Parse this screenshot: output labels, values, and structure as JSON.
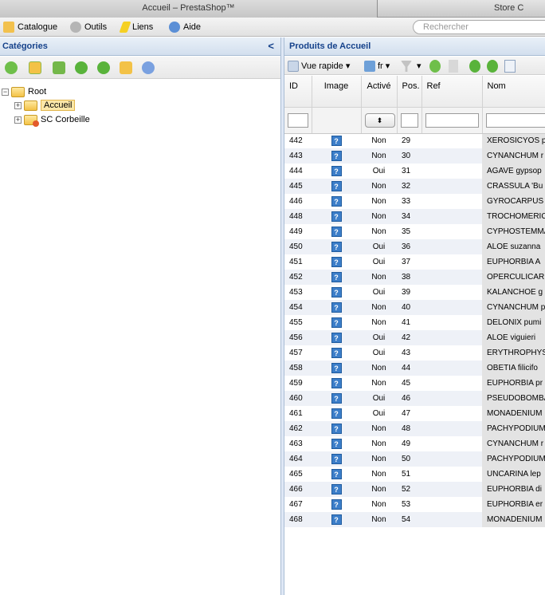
{
  "tabs": {
    "active": "Accueil – PrestaShop™",
    "second": "Store C"
  },
  "menu": {
    "items": [
      "Catalogue",
      "Outils",
      "Liens",
      "Aide"
    ],
    "search_placeholder": "Rechercher"
  },
  "left_panel": {
    "title": "Catégories",
    "collapse_glyph": "<",
    "toolbar_icons": [
      "refresh-icon",
      "expand-icon",
      "collapse-tree-icon",
      "add-icon",
      "add-subcategory-icon",
      "category-bin-icon",
      "help-icon"
    ],
    "tree": [
      {
        "label": "Root",
        "level": 0
      },
      {
        "label": "Accueil",
        "level": 1,
        "selected": true
      },
      {
        "label": "SC Corbeille",
        "level": 1
      }
    ]
  },
  "right_panel": {
    "title": "Produits de Accueil",
    "toolbar": {
      "view_label": "Vue rapide",
      "lang_label": "fr",
      "arrow": "▾"
    },
    "columns": [
      "ID",
      "Image",
      "Activé",
      "Pos.",
      "Ref",
      "Nom"
    ],
    "filter_select_glyph": "⬍",
    "rows": [
      [
        "442",
        "Non",
        "29",
        "XEROSICYOS p"
      ],
      [
        "443",
        "Non",
        "30",
        "CYNANCHUM r"
      ],
      [
        "444",
        "Oui",
        "31",
        "AGAVE gypsop"
      ],
      [
        "445",
        "Non",
        "32",
        "CRASSULA 'Bu"
      ],
      [
        "446",
        "Non",
        "33",
        "GYROCARPUS"
      ],
      [
        "448",
        "Non",
        "34",
        "TROCHOMERIC"
      ],
      [
        "449",
        "Non",
        "35",
        "CYPHOSTEMMA"
      ],
      [
        "450",
        "Oui",
        "36",
        "ALOE suzanna"
      ],
      [
        "451",
        "Oui",
        "37",
        "EUPHORBIA A"
      ],
      [
        "452",
        "Non",
        "38",
        "OPERCULICAR"
      ],
      [
        "453",
        "Oui",
        "39",
        "KALANCHOE g"
      ],
      [
        "454",
        "Non",
        "40",
        "CYNANCHUM p"
      ],
      [
        "455",
        "Non",
        "41",
        "DELONIX pumi"
      ],
      [
        "456",
        "Oui",
        "42",
        "ALOE viguieri"
      ],
      [
        "457",
        "Oui",
        "43",
        "ERYTHROPHYS"
      ],
      [
        "458",
        "Non",
        "44",
        "OBETIA filicifo"
      ],
      [
        "459",
        "Non",
        "45",
        "EUPHORBIA pr"
      ],
      [
        "460",
        "Oui",
        "46",
        "PSEUDOBOMBA"
      ],
      [
        "461",
        "Oui",
        "47",
        "MONADENIUM"
      ],
      [
        "462",
        "Non",
        "48",
        "PACHYPODIUM"
      ],
      [
        "463",
        "Non",
        "49",
        "CYNANCHUM r"
      ],
      [
        "464",
        "Non",
        "50",
        "PACHYPODIUM"
      ],
      [
        "465",
        "Non",
        "51",
        "UNCARINA lep"
      ],
      [
        "466",
        "Non",
        "52",
        "EUPHORBIA di"
      ],
      [
        "467",
        "Non",
        "53",
        "EUPHORBIA er"
      ],
      [
        "468",
        "Non",
        "54",
        "MONADENIUM"
      ]
    ],
    "image_placeholder": "?"
  },
  "colors": {
    "header_text": "#15428b",
    "selection": "#fbe7a8",
    "image_placeholder": "#3c7ec9"
  }
}
